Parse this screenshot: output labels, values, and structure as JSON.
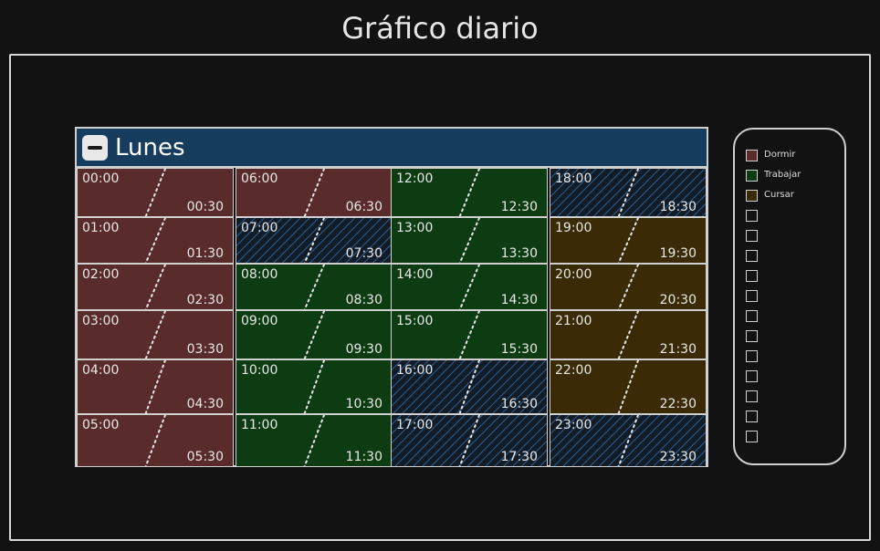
{
  "page_title": "Gráfico diario",
  "day": {
    "title": "Lunes"
  },
  "colors": {
    "dormir": "#5a2b2b",
    "trabajar": "#0e3c12",
    "cursar": "#3a2a06",
    "empty_hatch": "#2c5a88",
    "header": "#163d5e"
  },
  "columns": [
    [
      {
        "start": "00:00",
        "half": "00:30",
        "status": "dormir"
      },
      {
        "start": "01:00",
        "half": "01:30",
        "status": "dormir"
      },
      {
        "start": "02:00",
        "half": "02:30",
        "status": "dormir"
      },
      {
        "start": "03:00",
        "half": "03:30",
        "status": "dormir"
      },
      {
        "start": "04:00",
        "half": "04:30",
        "status": "dormir"
      },
      {
        "start": "05:00",
        "half": "05:30",
        "status": "dormir"
      }
    ],
    [
      {
        "start": "06:00",
        "half": "06:30",
        "status": "dormir"
      },
      {
        "start": "07:00",
        "half": "07:30",
        "status": "empty"
      },
      {
        "start": "08:00",
        "half": "08:30",
        "status": "trabajar"
      },
      {
        "start": "09:00",
        "half": "09:30",
        "status": "trabajar"
      },
      {
        "start": "10:00",
        "half": "10:30",
        "status": "trabajar"
      },
      {
        "start": "11:00",
        "half": "11:30",
        "status": "trabajar"
      }
    ],
    [
      {
        "start": "12:00",
        "half": "12:30",
        "status": "trabajar"
      },
      {
        "start": "13:00",
        "half": "13:30",
        "status": "trabajar"
      },
      {
        "start": "14:00",
        "half": "14:30",
        "status": "trabajar"
      },
      {
        "start": "15:00",
        "half": "15:30",
        "status": "trabajar"
      },
      {
        "start": "16:00",
        "half": "16:30",
        "status": "empty"
      },
      {
        "start": "17:00",
        "half": "17:30",
        "status": "empty"
      }
    ],
    [
      {
        "start": "18:00",
        "half": "18:30",
        "status": "empty"
      },
      {
        "start": "19:00",
        "half": "19:30",
        "status": "cursar"
      },
      {
        "start": "20:00",
        "half": "20:30",
        "status": "cursar"
      },
      {
        "start": "21:00",
        "half": "21:30",
        "status": "cursar"
      },
      {
        "start": "22:00",
        "half": "22:30",
        "status": "cursar"
      },
      {
        "start": "23:00",
        "half": "23:30",
        "status": "empty"
      }
    ]
  ],
  "legend": {
    "items": [
      {
        "label": "Dormir",
        "status": "dormir"
      },
      {
        "label": "Trabajar",
        "status": "trabajar"
      },
      {
        "label": "Cursar",
        "status": "cursar"
      }
    ],
    "empty_slots": 12
  }
}
